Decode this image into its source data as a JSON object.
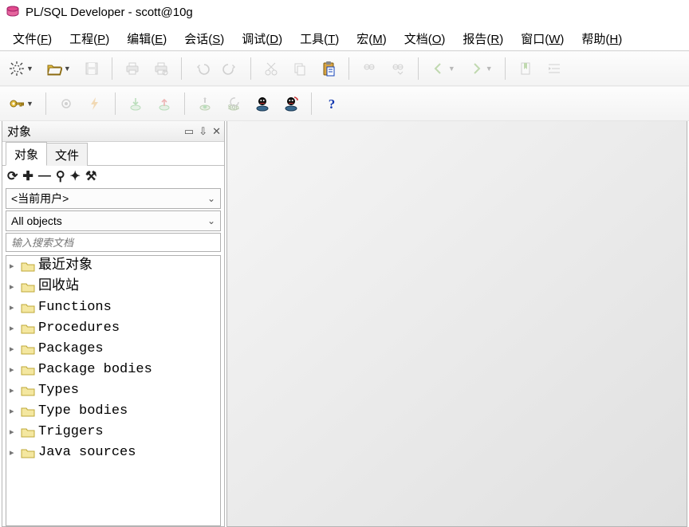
{
  "app": {
    "title": "PL/SQL Developer - scott@10g"
  },
  "menu": {
    "items": [
      {
        "label": "文件",
        "accel": "F"
      },
      {
        "label": "工程",
        "accel": "P"
      },
      {
        "label": "编辑",
        "accel": "E"
      },
      {
        "label": "会话",
        "accel": "S"
      },
      {
        "label": "调试",
        "accel": "D"
      },
      {
        "label": "工具",
        "accel": "T"
      },
      {
        "label": "宏",
        "accel": "M"
      },
      {
        "label": "文档",
        "accel": "O"
      },
      {
        "label": "报告",
        "accel": "R"
      },
      {
        "label": "窗口",
        "accel": "W"
      },
      {
        "label": "帮助",
        "accel": "H"
      }
    ]
  },
  "toolbar1": {
    "buttons": [
      {
        "name": "new-button",
        "icon": "sun",
        "dropdown": true,
        "disabled": false
      },
      {
        "name": "open-button",
        "icon": "open",
        "dropdown": true,
        "disabled": false
      },
      {
        "name": "save-button",
        "icon": "save",
        "disabled": true
      },
      {
        "name": "sep"
      },
      {
        "name": "print-button",
        "icon": "print",
        "disabled": true
      },
      {
        "name": "printsetup-button",
        "icon": "printset",
        "disabled": true
      },
      {
        "name": "sep"
      },
      {
        "name": "undo-button",
        "icon": "undo",
        "disabled": true
      },
      {
        "name": "redo-button",
        "icon": "redo",
        "disabled": true
      },
      {
        "name": "sep"
      },
      {
        "name": "cut-button",
        "icon": "cut",
        "disabled": true
      },
      {
        "name": "copy-button",
        "icon": "copy",
        "disabled": true
      },
      {
        "name": "paste-button",
        "icon": "paste",
        "disabled": false
      },
      {
        "name": "sep"
      },
      {
        "name": "find-button",
        "icon": "find",
        "disabled": true
      },
      {
        "name": "findnext-button",
        "icon": "findnext",
        "disabled": true
      },
      {
        "name": "sep"
      },
      {
        "name": "navback-button",
        "icon": "navback",
        "dropdown": true,
        "disabled": true
      },
      {
        "name": "navfwd-button",
        "icon": "navfwd",
        "dropdown": true,
        "disabled": true
      },
      {
        "name": "sep"
      },
      {
        "name": "bookmark-button",
        "icon": "bookmark",
        "disabled": true
      },
      {
        "name": "indent-button",
        "icon": "indent",
        "disabled": true
      }
    ]
  },
  "toolbar2": {
    "buttons": [
      {
        "name": "key-button",
        "icon": "key",
        "dropdown": true,
        "disabled": false
      },
      {
        "name": "sep"
      },
      {
        "name": "gear-button",
        "icon": "gear",
        "disabled": true
      },
      {
        "name": "bolt-button",
        "icon": "bolt",
        "disabled": true
      },
      {
        "name": "sep"
      },
      {
        "name": "exec-down-button",
        "icon": "execdown",
        "disabled": true
      },
      {
        "name": "exec-up-button",
        "icon": "execup",
        "disabled": true
      },
      {
        "name": "sep"
      },
      {
        "name": "commit-button",
        "icon": "commit",
        "disabled": true
      },
      {
        "name": "rollback-button",
        "icon": "rollback",
        "disabled": true
      },
      {
        "name": "session-a-button",
        "icon": "sessA",
        "disabled": false
      },
      {
        "name": "session-b-button",
        "icon": "sessB",
        "disabled": false
      },
      {
        "name": "sep"
      },
      {
        "name": "help-button",
        "icon": "help",
        "disabled": false
      }
    ]
  },
  "sidepanel": {
    "title": "对象",
    "tabs": [
      {
        "label": "对象",
        "active": true
      },
      {
        "label": "文件",
        "active": false
      }
    ],
    "minitools": [
      {
        "name": "refresh-icon",
        "glyph": "⟳"
      },
      {
        "name": "add-icon",
        "glyph": "✚"
      },
      {
        "name": "remove-icon",
        "glyph": "—"
      },
      {
        "name": "search-icon",
        "glyph": "⚲"
      },
      {
        "name": "wrench-icon",
        "glyph": "✦"
      },
      {
        "name": "options-icon",
        "glyph": "⚒"
      }
    ],
    "userCombo": "<当前用户>",
    "filterCombo": "All objects",
    "searchPlaceholder": "输入搜索文档",
    "tree": [
      {
        "label": "最近对象"
      },
      {
        "label": "回收站"
      },
      {
        "label": "Functions"
      },
      {
        "label": "Procedures"
      },
      {
        "label": "Packages"
      },
      {
        "label": "Package bodies"
      },
      {
        "label": "Types"
      },
      {
        "label": "Type bodies"
      },
      {
        "label": "Triggers"
      },
      {
        "label": "Java sources"
      }
    ]
  }
}
